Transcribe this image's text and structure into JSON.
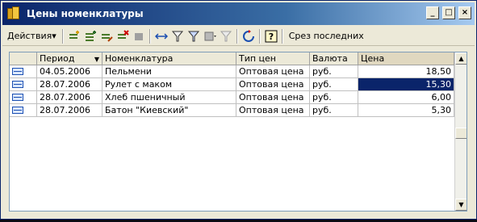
{
  "window": {
    "title": "Цены номенклатуры",
    "controls": {
      "minimize": "_",
      "maximize": "□",
      "close": "×"
    }
  },
  "toolbar": {
    "actions_label": "Действия",
    "actions_arrow": "▾",
    "srez_label": "Срез последних",
    "icons": [
      "add-icon",
      "add-copy-icon",
      "edit-icon",
      "delete-icon",
      "mark-icon",
      "period-icon",
      "filter-icon",
      "filter-set-icon",
      "filter-list-icon",
      "filter-off-icon",
      "refresh-icon",
      "help-icon"
    ]
  },
  "table": {
    "columns": [
      "",
      "Период",
      "Номенклатура",
      "Тип цен",
      "Валюта",
      "Цена"
    ],
    "sort_arrow": "▼",
    "rows": [
      {
        "period": "04.05.2006",
        "item": "Пельмени",
        "price_type": "Оптовая цена",
        "currency": "руб.",
        "price": "18,50"
      },
      {
        "period": "28.07.2006",
        "item": "Рулет с маком",
        "price_type": "Оптовая цена",
        "currency": "руб.",
        "price": "15,30"
      },
      {
        "period": "28.07.2006",
        "item": "Хлеб пшеничный",
        "price_type": "Оптовая цена",
        "currency": "руб.",
        "price": "6,00"
      },
      {
        "period": "28.07.2006",
        "item": "Батон \"Киевский\"",
        "price_type": "Оптовая цена",
        "currency": "руб.",
        "price": "5,30"
      }
    ],
    "selected_row": 1
  },
  "scrollbar": {
    "up": "▲",
    "down": "▼"
  },
  "colors": {
    "title_bar": "#0a246a",
    "selection": "#0a246a",
    "window_bg": "#ece9d8"
  }
}
